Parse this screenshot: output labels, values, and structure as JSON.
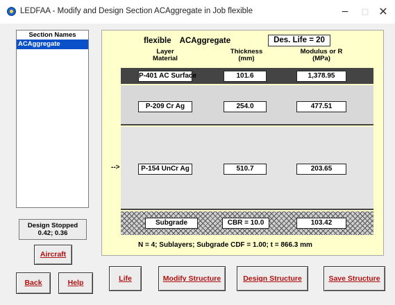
{
  "window": {
    "title": "LEDFAA - Modify and Design Section ACAggregate in Job flexible",
    "minimize": "−",
    "maximize": "□",
    "close": "✕"
  },
  "sections_panel": {
    "header": "Section Names",
    "items": [
      "ACAggregate"
    ],
    "selected_index": 0
  },
  "status": {
    "line1": "Design Stopped",
    "line2": "0.42;  0.36"
  },
  "buttons": {
    "aircraft": "Aircraft",
    "back": "Back",
    "help": "Help",
    "life": "Life",
    "modify_structure": "Modify Structure",
    "design_structure": "Design Structure",
    "save_structure": "Save Structure"
  },
  "structure": {
    "job": "flexible",
    "section": "ACAggregate",
    "design_life": "Des. Life = 20",
    "headers": {
      "material": [
        "Layer",
        "Material"
      ],
      "thickness": [
        "Thickness",
        "(mm)"
      ],
      "modulus": [
        "Modulus or R",
        "(MPa)"
      ]
    },
    "layers": [
      {
        "material": "P-401 AC Surface",
        "thickness": "101.6",
        "modulus": "1,378.95"
      },
      {
        "material": "P-209 Cr Ag",
        "thickness": "254.0",
        "modulus": "477.51"
      },
      {
        "material": "P-154 UnCr Ag",
        "thickness": "510.7",
        "modulus": "203.65"
      },
      {
        "material": "Subgrade",
        "thickness": "CBR = 10.0",
        "modulus": "103.42"
      }
    ],
    "arrow": "-->",
    "summary": "N = 4;  Sublayers;  Subgrade CDF = 1.00;  t = 866.3 mm"
  },
  "colors": {
    "selection": "#0a50c8",
    "panel_bg": "#ffffcc",
    "button_text": "#b01010",
    "dark_band": "#444444"
  }
}
